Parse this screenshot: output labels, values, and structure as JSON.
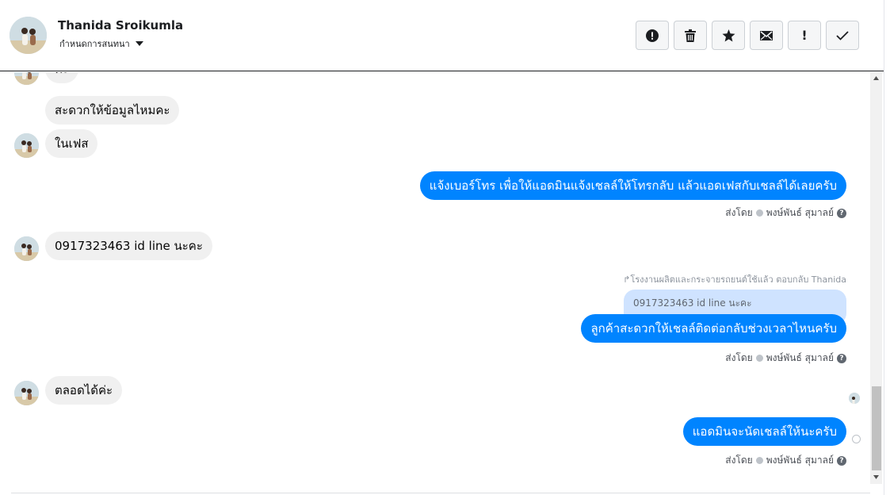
{
  "header": {
    "name": "Thanida Sroikumla",
    "subtitle": "กำหนดการสนทนา"
  },
  "toolbar": {
    "buttons": [
      {
        "icon": "alert-circle-icon"
      },
      {
        "icon": "trash-icon"
      },
      {
        "icon": "star-icon"
      },
      {
        "icon": "envelope-icon"
      },
      {
        "icon": "exclamation-icon",
        "label": "!"
      },
      {
        "icon": "checkmark-icon"
      }
    ]
  },
  "messages": [
    {
      "from": "contact",
      "text": "ค่ะ"
    },
    {
      "from": "contact",
      "text": "สะดวกให้ข้อมูลไหมคะ"
    },
    {
      "from": "contact",
      "text": "ในเฟส"
    },
    {
      "from": "page",
      "text": "แจ้งเบอร์โทร เพื่อให้แอดมินแจ้งเชลล์ให้โทรกลับ แล้วแอดเฟสกับเชลล์ได้เลยครับ"
    },
    {
      "from": "contact",
      "text": "0917323463 id line นะคะ"
    },
    {
      "from": "page",
      "text": "ลูกค้าสะดวกให้เชลล์ติดต่อกลับช่วงเวลาไหนครับ"
    },
    {
      "from": "contact",
      "text": "ตลอดได้ค่ะ"
    },
    {
      "from": "page",
      "text": "แอดมินจะนัดเชลล์ให้นะครับ"
    }
  ],
  "sent_by": {
    "prefix": "ส่งโดย",
    "name": "พงษ์พันธ์ สุมาลย์",
    "help": "?"
  },
  "reply": {
    "meta": "โรงงานผลิตและกระจายรถยนต์ใช้แล้ว ตอบกลับ Thanida",
    "quoted": "0917323463 id line นะคะ"
  },
  "colors": {
    "outgoing_bubble": "#0084ff",
    "incoming_bubble": "#f0f0f0",
    "quoted_bubble": "#cfe3ff"
  }
}
